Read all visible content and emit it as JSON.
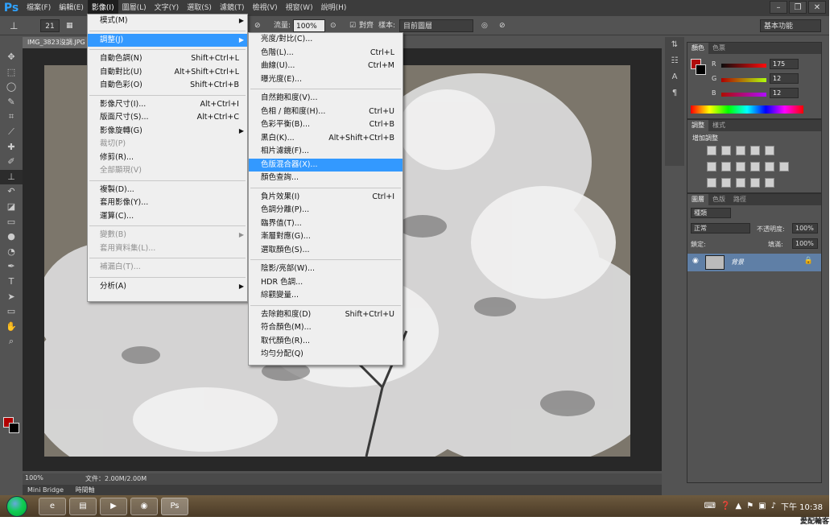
{
  "menubar": {
    "logo": "Ps",
    "items": [
      {
        "label": "檔案(F)"
      },
      {
        "label": "編輯(E)"
      },
      {
        "label": "影像(I)",
        "active": true
      },
      {
        "label": "圖層(L)"
      },
      {
        "label": "文字(Y)"
      },
      {
        "label": "選取(S)"
      },
      {
        "label": "濾鏡(T)"
      },
      {
        "label": "檢視(V)"
      },
      {
        "label": "視窗(W)"
      },
      {
        "label": "說明(H)"
      }
    ],
    "window_controls": [
      "–",
      "❐",
      "✕"
    ]
  },
  "options": {
    "brush_size": "21",
    "flow_label": "流量:",
    "flow_value": "100%",
    "aligned_label": "對齊",
    "sample_label": "樣本:",
    "sample_value": "目前圖層",
    "workspace": "基本功能"
  },
  "document": {
    "tab": "IMG_3823沒調.JPG",
    "zoom": "100%",
    "size": "文件：2.00M/2.00M"
  },
  "bridge": {
    "tabs": [
      "Mini Bridge",
      "時間軸"
    ]
  },
  "image_menu": {
    "items": [
      {
        "label": "模式(M)",
        "shortcut": "",
        "submenu": true
      },
      {
        "sep": true
      },
      {
        "label": "調整(J)",
        "shortcut": "",
        "submenu": true,
        "highlight": true
      },
      {
        "sep": true
      },
      {
        "label": "自動色調(N)",
        "shortcut": "Shift+Ctrl+L"
      },
      {
        "label": "自動對比(U)",
        "shortcut": "Alt+Shift+Ctrl+L"
      },
      {
        "label": "自動色彩(O)",
        "shortcut": "Shift+Ctrl+B"
      },
      {
        "sep": true
      },
      {
        "label": "影像尺寸(I)...",
        "shortcut": "Alt+Ctrl+I"
      },
      {
        "label": "版面尺寸(S)...",
        "shortcut": "Alt+Ctrl+C"
      },
      {
        "label": "影像旋轉(G)",
        "shortcut": "",
        "submenu": true
      },
      {
        "label": "裁切(P)",
        "disabled": true
      },
      {
        "label": "修剪(R)..."
      },
      {
        "label": "全部顯現(V)",
        "disabled": true
      },
      {
        "sep": true
      },
      {
        "label": "複製(D)..."
      },
      {
        "label": "套用影像(Y)..."
      },
      {
        "label": "運算(C)..."
      },
      {
        "sep": true
      },
      {
        "label": "變數(B)",
        "disabled": true,
        "submenu": true
      },
      {
        "label": "套用資料集(L)...",
        "disabled": true
      },
      {
        "sep": true
      },
      {
        "label": "補漏白(T)...",
        "disabled": true
      },
      {
        "sep": true
      },
      {
        "label": "分析(A)",
        "submenu": true
      }
    ]
  },
  "adjust_menu": {
    "items": [
      {
        "label": "亮度/對比(C)..."
      },
      {
        "label": "色階(L)...",
        "shortcut": "Ctrl+L"
      },
      {
        "label": "曲線(U)...",
        "shortcut": "Ctrl+M"
      },
      {
        "label": "曝光度(E)..."
      },
      {
        "sep": true
      },
      {
        "label": "自然飽和度(V)..."
      },
      {
        "label": "色相 / 飽和度(H)...",
        "shortcut": "Ctrl+U"
      },
      {
        "label": "色彩平衡(B)...",
        "shortcut": "Ctrl+B"
      },
      {
        "label": "黑白(K)...",
        "shortcut": "Alt+Shift+Ctrl+B"
      },
      {
        "label": "相片濾鏡(F)..."
      },
      {
        "label": "色版混合器(X)...",
        "highlight": true
      },
      {
        "label": "顏色查詢..."
      },
      {
        "sep": true
      },
      {
        "label": "負片效果(I)",
        "shortcut": "Ctrl+I"
      },
      {
        "label": "色調分離(P)..."
      },
      {
        "label": "臨界值(T)..."
      },
      {
        "label": "漸層對應(G)..."
      },
      {
        "label": "選取顏色(S)..."
      },
      {
        "sep": true
      },
      {
        "label": "陰影/亮部(W)..."
      },
      {
        "label": "HDR 色調..."
      },
      {
        "label": "綜觀變量..."
      },
      {
        "sep": true
      },
      {
        "label": "去除飽和度(D)",
        "shortcut": "Shift+Ctrl+U"
      },
      {
        "label": "符合顏色(M)..."
      },
      {
        "label": "取代顏色(R)..."
      },
      {
        "label": "均勻分配(Q)"
      }
    ]
  },
  "color_panel": {
    "tabs": [
      "顏色",
      "色票"
    ],
    "r_label": "R",
    "r_value": "175",
    "g_label": "G",
    "g_value": "12",
    "b_label": "B",
    "b_value": "12",
    "fg_color": "#af0c0c"
  },
  "adjust_panel": {
    "tabs": [
      "調整",
      "樣式"
    ],
    "title": "增加調整"
  },
  "layers_panel": {
    "tabs": [
      "圖層",
      "色版",
      "路徑"
    ],
    "kind": "種類",
    "blend_mode": "正常",
    "opacity_label": "不透明度:",
    "opacity_value": "100%",
    "lock_label": "鎖定:",
    "fill_label": "填滿:",
    "fill_value": "100%",
    "layer_name": "背景"
  },
  "taskbar": {
    "clock": "下午 10:38",
    "apps": [
      "e",
      "▤",
      "▶",
      "◉",
      "Ps"
    ]
  },
  "watermark": "愛配輪客"
}
